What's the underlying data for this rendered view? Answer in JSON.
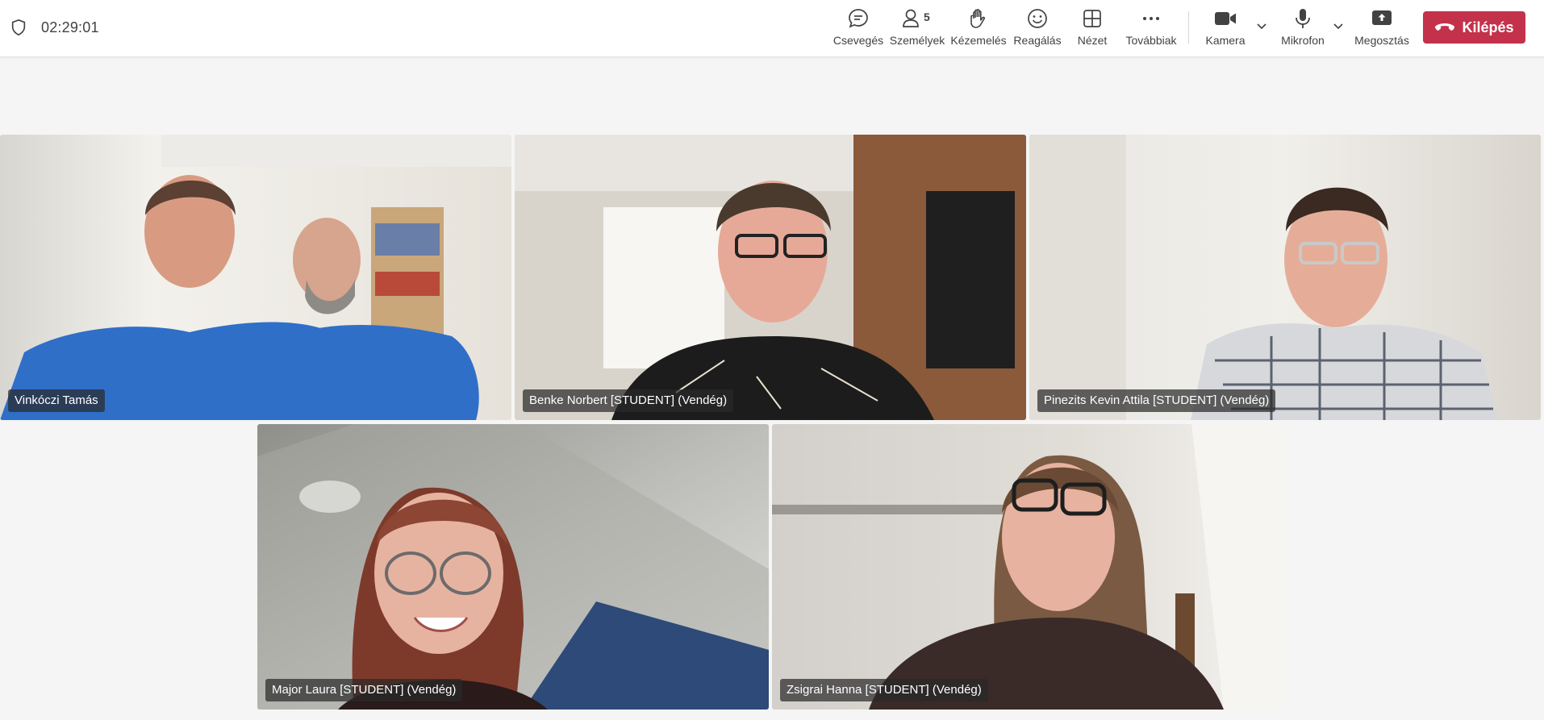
{
  "meeting": {
    "timer": "02:29:01"
  },
  "toolbar": {
    "chat": {
      "label": "Csevegés",
      "icon": "chat-icon"
    },
    "people": {
      "label": "Személyek",
      "count": "5",
      "icon": "people-icon"
    },
    "raise_hand": {
      "label": "Kézemelés",
      "icon": "hand-icon"
    },
    "react": {
      "label": "Reagálás",
      "icon": "smile-icon"
    },
    "view": {
      "label": "Nézet",
      "icon": "grid-icon"
    },
    "more": {
      "label": "Továbbiak",
      "icon": "more-icon"
    },
    "camera": {
      "label": "Kamera",
      "icon": "camera-icon"
    },
    "mic": {
      "label": "Mikrofon",
      "icon": "mic-icon"
    },
    "share": {
      "label": "Megosztás",
      "icon": "share-icon"
    },
    "leave": {
      "label": "Kilépés",
      "icon": "phone-hangup-icon",
      "color": "#c4314b"
    }
  },
  "participants": [
    {
      "name": "Vinkóczi Tamás"
    },
    {
      "name": "Benke Norbert [STUDENT] (Vendég)"
    },
    {
      "name": "Pinezits Kevin Attila [STUDENT] (Vendég)"
    },
    {
      "name": "Major Laura [STUDENT] (Vendég)"
    },
    {
      "name": "Zsigrai Hanna [STUDENT] (Vendég)"
    }
  ]
}
